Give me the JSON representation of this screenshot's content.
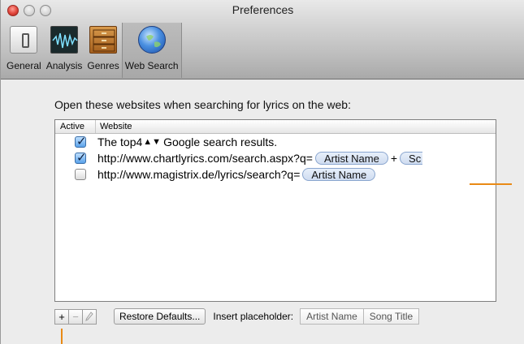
{
  "window": {
    "title": "Preferences"
  },
  "toolbar": {
    "items": [
      {
        "label": "General",
        "icon": "general-switch-icon"
      },
      {
        "label": "Analysis",
        "icon": "waveform-icon"
      },
      {
        "label": "Genres",
        "icon": "cabinet-icon"
      },
      {
        "label": "Web Search",
        "icon": "globe-icon",
        "selected": true
      }
    ]
  },
  "prompt": "Open these websites when searching for lyrics on the web:",
  "table": {
    "columns": [
      "Active",
      "Website"
    ],
    "rows": [
      {
        "active": true,
        "parts": {
          "pre": "The top ",
          "count": "4",
          "stepper": "▲▼",
          "post": " Google search results."
        }
      },
      {
        "active": true,
        "parts": {
          "url": "http://www.chartlyrics.com/search.aspx?q=",
          "token1": "Artist Name",
          "plus": "+",
          "token2": "Sc"
        }
      },
      {
        "active": false,
        "parts": {
          "url": "http://www.magistrix.de/lyrics/search?q=",
          "token1": "Artist Name"
        }
      }
    ]
  },
  "buttons": {
    "add": "+",
    "remove": "−",
    "edit_icon": "pencil-icon",
    "restore": "Restore Defaults...",
    "insert_label": "Insert placeholder:",
    "placeholders": [
      "Artist Name",
      "Song Title"
    ]
  },
  "colors": {
    "annotation": "#e98a15",
    "selected_tab": "#a8a8a8",
    "token_fill": "#cfdcf0"
  }
}
